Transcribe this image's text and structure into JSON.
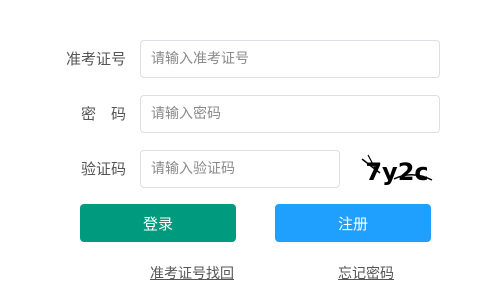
{
  "form": {
    "exam_number_label": "准考证号",
    "exam_number_placeholder": "请输入准考证号",
    "password_label": "密　码",
    "password_placeholder": "请输入密码",
    "captcha_label": "验证码",
    "captcha_placeholder": "请输入验证码",
    "captcha_text": "7y2c"
  },
  "buttons": {
    "login_label": "登录",
    "register_label": "注册"
  },
  "links": {
    "recover_exam_number": "准考证号找回",
    "forgot_password": "忘记密码"
  },
  "colors": {
    "login_button": "#009a7e",
    "register_button": "#1fa0ff",
    "input_border": "#dcdfe6"
  }
}
